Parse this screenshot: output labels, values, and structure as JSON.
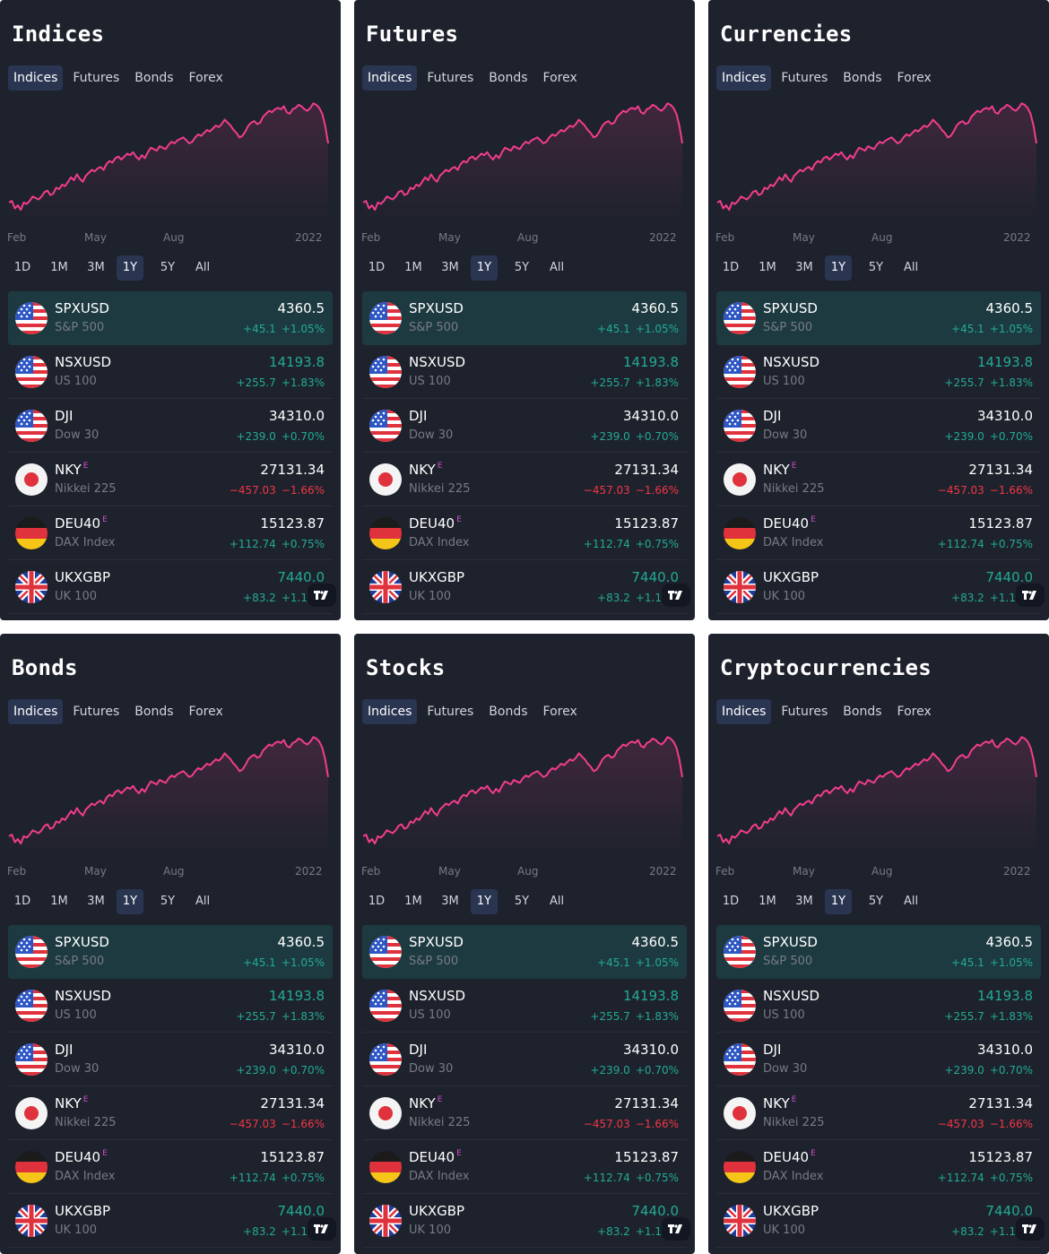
{
  "colors": {
    "accent": "#f23d8c",
    "up": "#22ab94",
    "down": "#f23645",
    "panel": "#1e222d",
    "selected_row": "#1d3a41",
    "active_tab": "#2a3552"
  },
  "widgets": [
    {
      "title": "Indices"
    },
    {
      "title": "Futures"
    },
    {
      "title": "Currencies"
    },
    {
      "title": "Bonds"
    },
    {
      "title": "Stocks"
    },
    {
      "title": "Cryptocurrencies"
    }
  ],
  "tabs": [
    "Indices",
    "Futures",
    "Bonds",
    "Forex"
  ],
  "active_tab": "Indices",
  "ranges": [
    "1D",
    "1M",
    "3M",
    "1Y",
    "5Y",
    "All"
  ],
  "active_range": "1Y",
  "chart_data": {
    "type": "area",
    "x_ticks": [
      "Feb",
      "May",
      "Aug",
      "2022"
    ],
    "values": [
      4160,
      4170,
      4120,
      4140,
      4110,
      4160,
      4150,
      4170,
      4200,
      4190,
      4180,
      4200,
      4230,
      4240,
      4210,
      4220,
      4260,
      4250,
      4280,
      4270,
      4300,
      4330,
      4310,
      4350,
      4320,
      4300,
      4340,
      4360,
      4380,
      4370,
      4390,
      4400,
      4380,
      4420,
      4440,
      4430,
      4460,
      4470,
      4450,
      4470,
      4490,
      4480,
      4500,
      4470,
      4450,
      4480,
      4460,
      4500,
      4530,
      4520,
      4510,
      4540,
      4530,
      4520,
      4550,
      4570,
      4560,
      4580,
      4590,
      4600,
      4580,
      4560,
      4570,
      4600,
      4620,
      4610,
      4630,
      4650,
      4640,
      4660,
      4680,
      4670,
      4690,
      4720,
      4700,
      4680,
      4650,
      4630,
      4600,
      4610,
      4640,
      4680,
      4700,
      4710,
      4690,
      4700,
      4740,
      4760,
      4780,
      4770,
      4790,
      4800,
      4790,
      4810,
      4770,
      4760,
      4790,
      4800,
      4820,
      4810,
      4790,
      4780,
      4800,
      4830,
      4820,
      4800,
      4760,
      4680,
      4560
    ],
    "ylim": [
      4050,
      4850
    ]
  },
  "rows": [
    {
      "symbol": "SPXUSD",
      "sup": "",
      "desc": "S&P 500",
      "price": "4360.5",
      "price_up": false,
      "change": "+45.1",
      "pct": "+1.05%",
      "dir": "up",
      "flag": "us",
      "selected": true
    },
    {
      "symbol": "NSXUSD",
      "sup": "",
      "desc": "US 100",
      "price": "14193.8",
      "price_up": true,
      "change": "+255.7",
      "pct": "+1.83%",
      "dir": "up",
      "flag": "us",
      "selected": false
    },
    {
      "symbol": "DJI",
      "sup": "",
      "desc": "Dow 30",
      "price": "34310.0",
      "price_up": false,
      "change": "+239.0",
      "pct": "+0.70%",
      "dir": "up",
      "flag": "us",
      "selected": false
    },
    {
      "symbol": "NKY",
      "sup": "E",
      "desc": "Nikkei 225",
      "price": "27131.34",
      "price_up": false,
      "change": "−457.03",
      "pct": "−1.66%",
      "dir": "down",
      "flag": "jp",
      "selected": false
    },
    {
      "symbol": "DEU40",
      "sup": "E",
      "desc": "DAX Index",
      "price": "15123.87",
      "price_up": false,
      "change": "+112.74",
      "pct": "+0.75%",
      "dir": "up",
      "flag": "de",
      "selected": false
    },
    {
      "symbol": "UKXGBP",
      "sup": "",
      "desc": "UK 100",
      "price": "7440.0",
      "price_up": true,
      "change": "+83.2",
      "pct": "+1.13%",
      "dir": "up",
      "flag": "gb",
      "selected": false
    }
  ]
}
